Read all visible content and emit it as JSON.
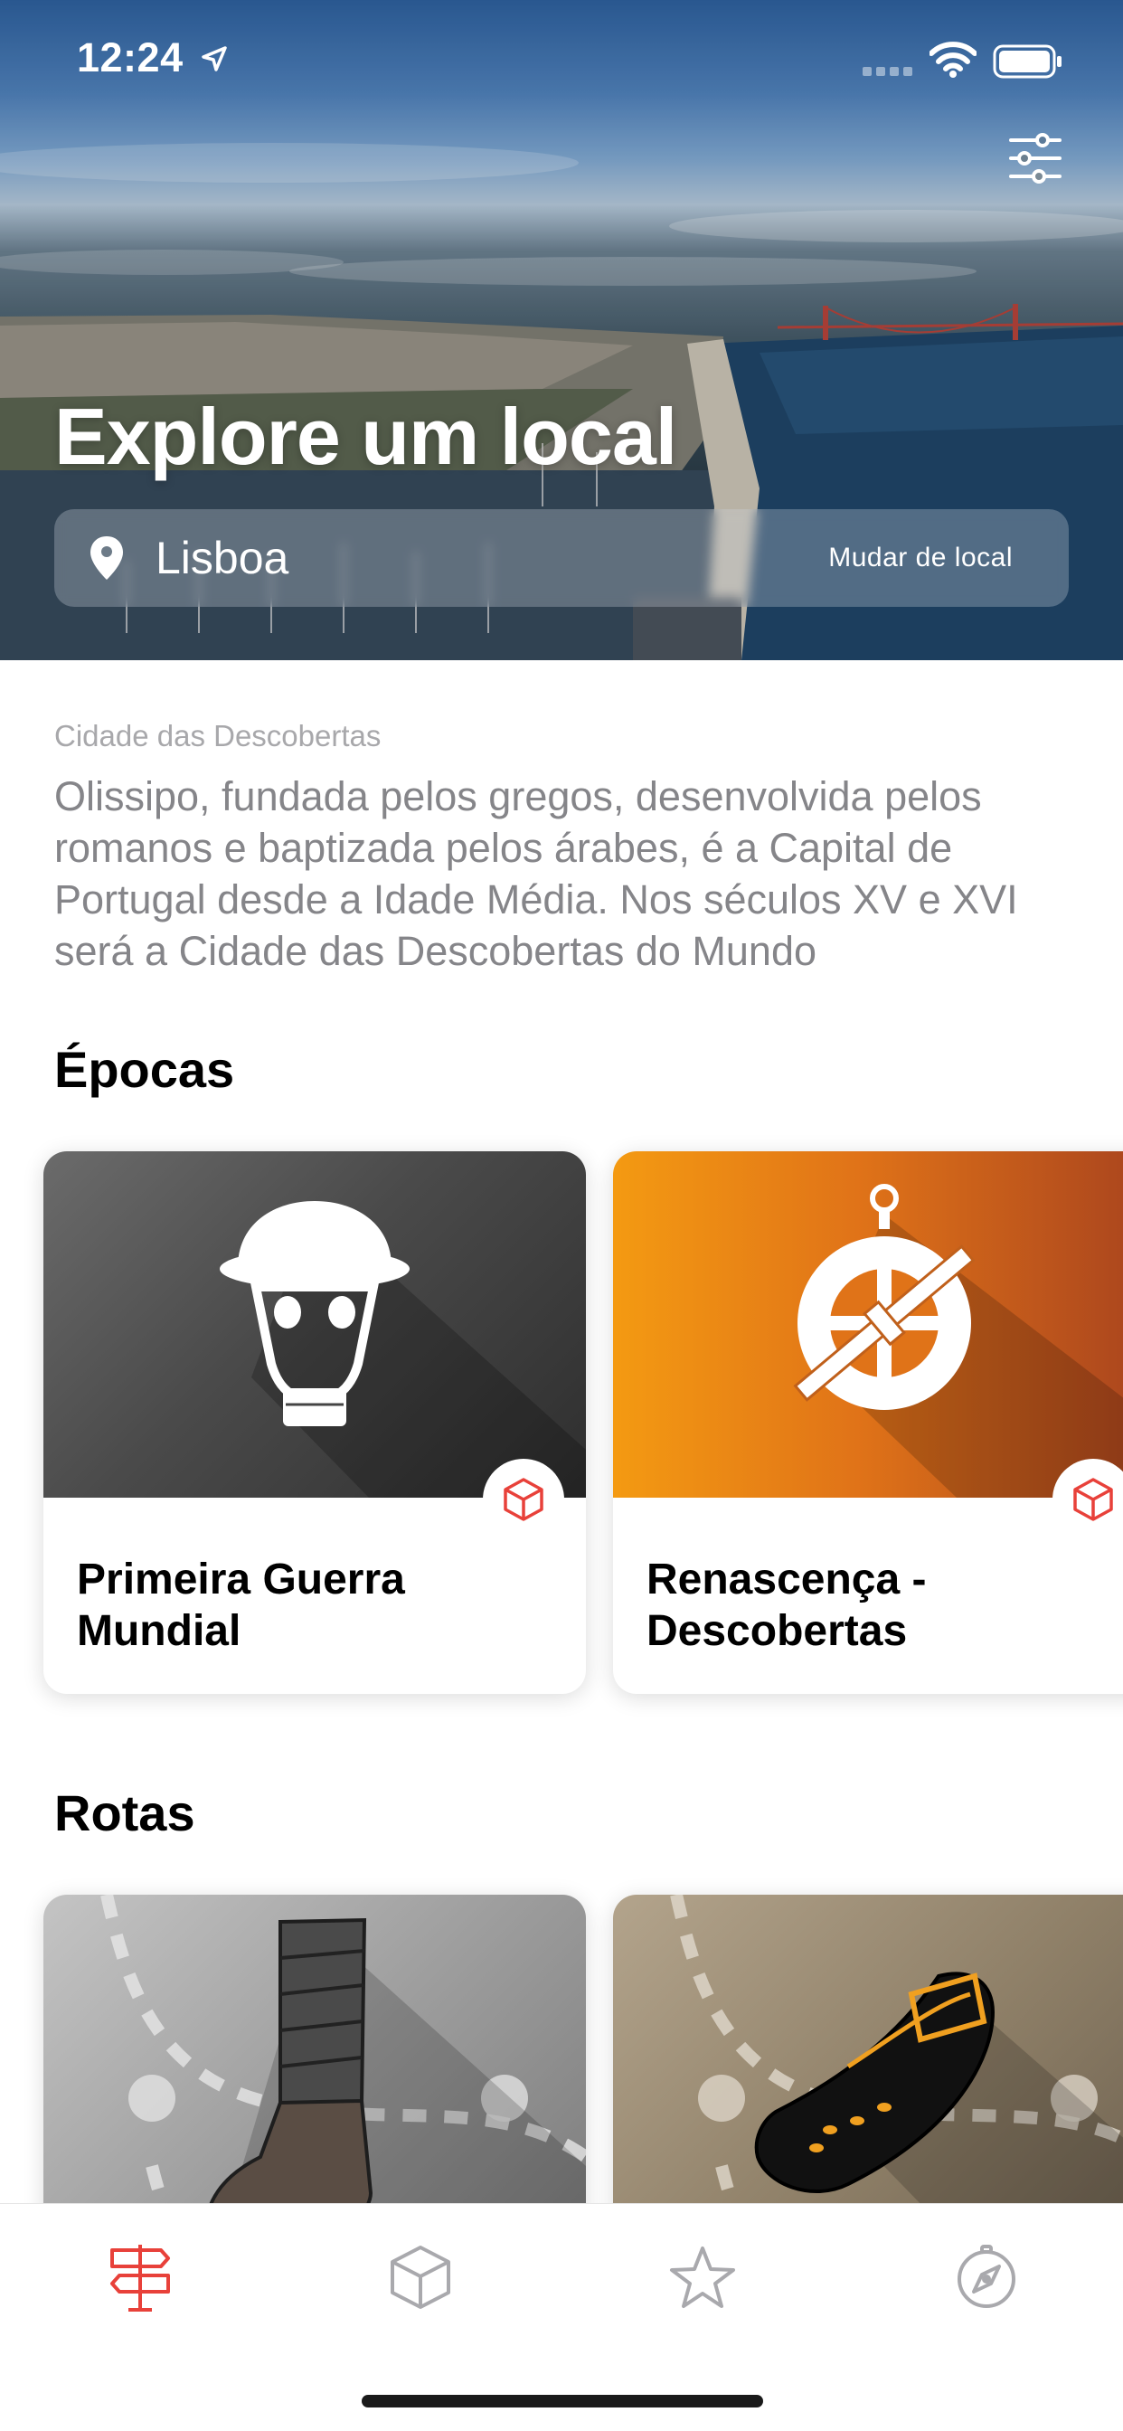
{
  "status_bar": {
    "time": "12:24"
  },
  "hero": {
    "title": "Explore um local",
    "location": {
      "name": "Lisboa",
      "change_label": "Mudar de local"
    }
  },
  "intro": {
    "subtitle": "Cidade das Descobertas",
    "description": "Olissipo, fundada pelos gregos, desenvolvida pelos romanos e baptizada pelos árabes, é a Capital de Portugal desde a Idade Média. Nos séculos XV e XVI será a Cidade das Descobertas do Mundo"
  },
  "epocas": {
    "title": "Épocas",
    "items": [
      {
        "title": "Primeira Guerra Mundial",
        "icon": "gas-mask-soldier-icon"
      },
      {
        "title": "Renascença - Descobertas",
        "icon": "astrolabe-icon"
      }
    ]
  },
  "rotas": {
    "title": "Rotas",
    "items": [
      {
        "icon": "military-boot-icon"
      },
      {
        "icon": "renaissance-shoe-icon"
      }
    ]
  },
  "tab_bar": {
    "items": [
      {
        "icon": "signpost-icon",
        "active": true
      },
      {
        "icon": "cube-icon",
        "active": false
      },
      {
        "icon": "star-icon",
        "active": false
      },
      {
        "icon": "compass-icon",
        "active": false
      }
    ]
  },
  "colors": {
    "accent": "#e8413a",
    "inactive": "#a9a9ad",
    "text_secondary": "#858589"
  }
}
